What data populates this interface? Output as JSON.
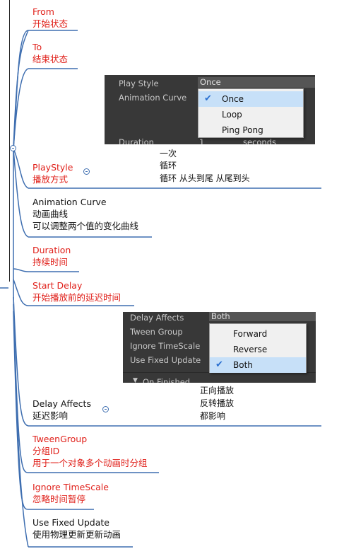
{
  "nodes": {
    "from": {
      "title": "From",
      "desc": "开始状态"
    },
    "to": {
      "title": "To",
      "desc": "结束状态"
    },
    "playstyle": {
      "title": "PlayStyle",
      "desc": "播放方式",
      "notes": [
        "一次",
        "循环",
        "循环 从头到尾 从尾到头"
      ]
    },
    "animation_curve": {
      "title": "Animation Curve",
      "desc1": "动画曲线",
      "desc2": "可以调整两个值的变化曲线"
    },
    "duration": {
      "title": "Duration",
      "desc": "持续时间"
    },
    "start_delay": {
      "title": "Start Delay",
      "desc": "开始播放前的延迟时间"
    },
    "delay_affects": {
      "title": "Delay Affects",
      "desc": "延迟影响",
      "notes": [
        "正向播放",
        "反转播放",
        "都影响"
      ]
    },
    "tween_group": {
      "title": "TweenGroup",
      "desc1": "分组ID",
      "desc2": "用于一个对象多个动画时分组"
    },
    "ignore_timescale": {
      "title": "Ignore TimeScale",
      "desc": "忽略时间暂停"
    },
    "use_fixed_update": {
      "title": "Use Fixed Update",
      "desc": "使用物理更新更新动画"
    }
  },
  "panel1": {
    "rows": [
      "Play Style",
      "Animation Curve",
      "Duration"
    ],
    "play_style_value": "Once",
    "duration_value": "1",
    "duration_unit": "seconds",
    "dropdown": {
      "items": [
        "Once",
        "Loop",
        "Ping Pong"
      ],
      "selected": "Once"
    }
  },
  "panel2": {
    "rows": [
      "Delay Affects",
      "Tween Group",
      "Ignore TimeScale",
      "Use Fixed Update"
    ],
    "delay_affects_value": "Both",
    "footer_text": "On Finished",
    "dropdown": {
      "items": [
        "Forward",
        "Reverse",
        "Both"
      ],
      "selected": "Both"
    }
  },
  "colors": {
    "line": "#3e6eb0",
    "red_text": "#e0201a",
    "panel_bg": "#383838",
    "menu_bg": "#f0f0f0",
    "selected_bg": "#c7e0f8"
  }
}
